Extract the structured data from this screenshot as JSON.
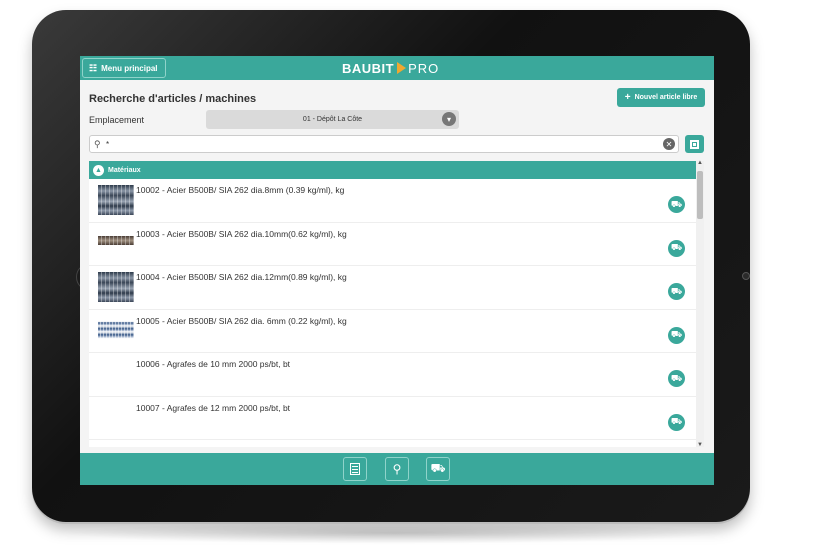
{
  "header": {
    "menu_label": "Menu principal",
    "brand_part1": "BAUBIT",
    "brand_part2": "PRO"
  },
  "page": {
    "title": "Recherche d'articles / machines",
    "new_button_label": "Nouvel article libre"
  },
  "location": {
    "label": "Emplacement",
    "selected": "01 - Dépôt La Côte"
  },
  "search": {
    "value": "*"
  },
  "section": {
    "title": "Matériaux"
  },
  "items": [
    {
      "label": "10002 - Acier B500B/ SIA 262 dia.8mm (0.39 kg/ml), kg",
      "thumb": "rebar"
    },
    {
      "label": "10003 - Acier B500B/ SIA 262 dia.10mm(0.62 kg/ml), kg",
      "thumb": "rebar-thin"
    },
    {
      "label": "10004 - Acier B500B/ SIA 262 dia.12mm(0.89 kg/ml), kg",
      "thumb": "rebar"
    },
    {
      "label": "10005 - Acier B500B/ SIA 262 dia. 6mm (0.22 kg/ml), kg",
      "thumb": "rebar-blue"
    },
    {
      "label": "10006 - Agrafes de 10 mm 2000 ps/bt, bt",
      "thumb": "none"
    },
    {
      "label": "10007 - Agrafes de 12 mm 2000 ps/bt, bt",
      "thumb": "none"
    }
  ],
  "colors": {
    "accent": "#3aa89b",
    "brand_triangle": "#f0a830"
  },
  "icons": {
    "menu": "menu-icon",
    "add_item": "add-to-cart-icon",
    "list": "list-icon",
    "search": "search-icon",
    "scan": "scan-icon"
  }
}
